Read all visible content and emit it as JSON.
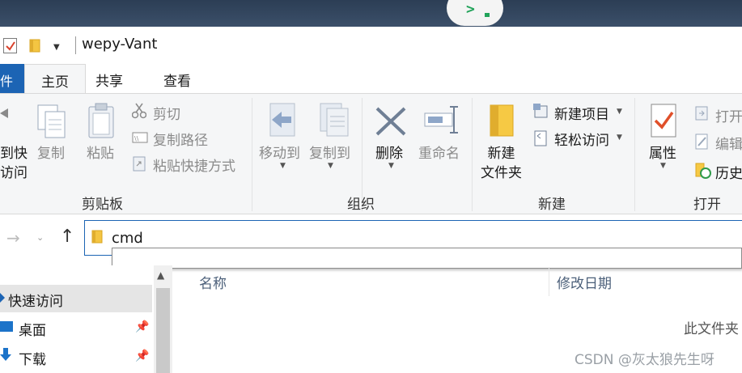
{
  "window": {
    "title": "wepy-Vant"
  },
  "tabs": {
    "file": "件",
    "home": "主页",
    "share": "共享",
    "view": "查看"
  },
  "ribbon": {
    "clipboard": {
      "pin_label_1": "到快",
      "pin_label_2": "访问",
      "copy": "复制",
      "paste": "粘贴",
      "cut": "剪切",
      "copy_path": "复制路径",
      "paste_shortcut": "粘贴快捷方式",
      "group": "剪贴板"
    },
    "organize": {
      "move_to": "移动到",
      "copy_to": "复制到",
      "delete": "删除",
      "rename": "重命名",
      "group": "组织"
    },
    "new": {
      "new_folder_1": "新建",
      "new_folder_2": "文件夹",
      "new_item": "新建项目",
      "easy_access": "轻松访问",
      "group": "新建"
    },
    "open": {
      "properties": "属性",
      "open": "打开",
      "edit": "编辑",
      "history": "历史",
      "group": "打开"
    }
  },
  "address": {
    "value": "cmd"
  },
  "nav": {
    "quick_access": "快速访问",
    "items": [
      {
        "label": "桌面"
      },
      {
        "label": "下载"
      }
    ]
  },
  "columns": {
    "name": "名称",
    "date": "修改日期"
  },
  "content": {
    "empty_message": "此文件夹"
  },
  "watermark": "CSDN @灰太狼先生呀",
  "colors": {
    "accent": "#1c64b4",
    "terminal_green": "#22a35a",
    "ribbon_bg": "#f5f6f7"
  },
  "icons": {
    "terminal": "terminal-icon",
    "folder": "folder-icon",
    "cut": "scissors-icon",
    "delete": "x-icon",
    "properties": "checkmark-doc-icon"
  }
}
